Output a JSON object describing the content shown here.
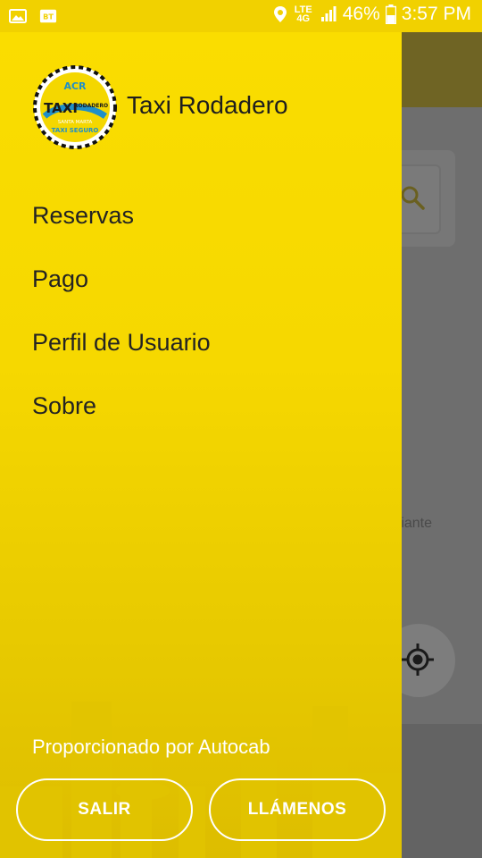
{
  "status_bar": {
    "battery": "46%",
    "time": "3:57 PM",
    "network_line1": "LTE",
    "network_line2": "4G",
    "icons": [
      "image-icon",
      "bluetooth-audio-icon",
      "location-icon",
      "signal-icon",
      "battery-icon"
    ]
  },
  "drawer": {
    "app_title": "Taxi Rodadero",
    "logo": {
      "brand_top": "ACR",
      "brand_main": "TAXI",
      "brand_side": "RODADERO",
      "city": "SANTA MARTA",
      "slogan": "TAXI SEGURO"
    },
    "menu": [
      {
        "label": "Reservas"
      },
      {
        "label": "Pago"
      },
      {
        "label": "Perfil de Usuario"
      },
      {
        "label": "Sobre"
      }
    ],
    "powered_by": "Proporcionado por Autocab",
    "buttons": {
      "logout": "SALIR",
      "call": "LLÁMENOS"
    }
  },
  "background_app": {
    "map_label": "riante"
  },
  "colors": {
    "drawer_top": "#fadd00",
    "drawer_bottom": "#ddbd00",
    "status_bar": "#f1d100",
    "text_dark": "#232323",
    "button_border": "#ffffff"
  }
}
